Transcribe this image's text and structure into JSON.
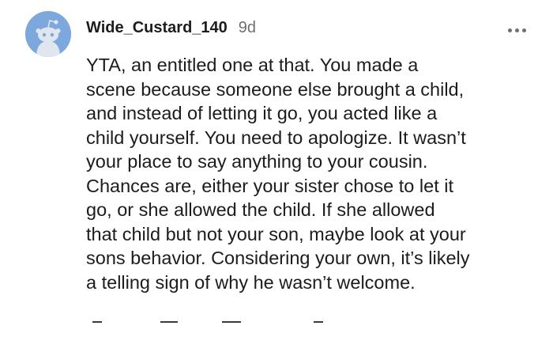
{
  "comment": {
    "username": "Wide_Custard_140",
    "age": "9d",
    "more_icon": "more-horizontal-icon",
    "body_lines": [
      "YTA, an entitled one at that. You made a",
      "scene because someone else brought a child,",
      "and instead of letting it go, you acted like a",
      "child yourself. You need to apologize. It wasn’t",
      "your place to say anything to your cousin.",
      "Chances are, either your sister chose to let it",
      "go, or she allowed the child. If she allowed",
      "that child but not your son, maybe look at your",
      "sons behavior. Considering your own, it’s likely",
      "a telling sign of why he wasn’t welcome."
    ],
    "avatar_color": "#7da8dd",
    "actions": [
      "upvote-icon",
      "reply-icon",
      "award-icon",
      "share-icon"
    ]
  }
}
